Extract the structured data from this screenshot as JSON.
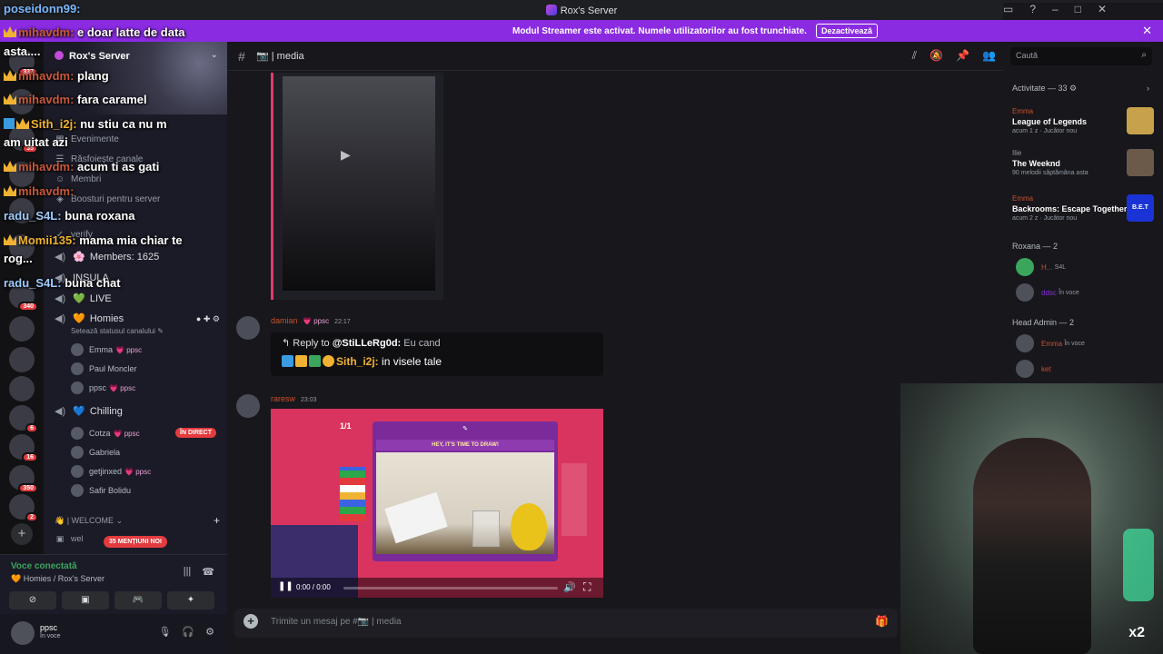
{
  "window": {
    "title": "Rox's Server"
  },
  "banner": {
    "text": "Modul Streamer este activat. Numele utilizatorilor au fost trunchiate.",
    "button": "Dezactivează",
    "close": "✕"
  },
  "overlay": {
    "top_user": "poseidonn99:",
    "lines": [
      {
        "name": "mihavdm:",
        "text": " e doar latte de data"
      },
      {
        "name": "",
        "text": "asta...."
      },
      {
        "name": "mihavdm:",
        "text": " plang"
      },
      {
        "name": "mihavdm:",
        "text": " fara caramel"
      },
      {
        "name": "Sith_i2j:",
        "text": " nu stiu ca nu m"
      },
      {
        "name": "",
        "text": "am uitat azi"
      },
      {
        "name": "mihavdm:",
        "text": " acum ti as gati"
      },
      {
        "name": "mihavdm:",
        "text": ""
      },
      {
        "name": "radu_S4L:",
        "text": " buna roxana"
      },
      {
        "name": "Momii135:",
        "text": " mama mia chiar te"
      },
      {
        "name": "",
        "text": "rog..."
      },
      {
        "name": "radu_S4L:",
        "text": " buna chat"
      }
    ]
  },
  "rail": {
    "badges": [
      "337",
      "35",
      "340",
      "6",
      "16",
      "350",
      "2"
    ]
  },
  "sidebar": {
    "server_name": "Rox's Server",
    "rows": [
      {
        "icon": "calendar-icon",
        "label": "Evenimente"
      },
      {
        "icon": "browse-icon",
        "label": "Răsfoiește canale"
      },
      {
        "icon": "members-icon",
        "label": "Membri"
      },
      {
        "icon": "boost-icon",
        "label": "Boosturi pentru server"
      },
      {
        "icon": "check-icon",
        "label": "verify"
      }
    ],
    "voice": [
      {
        "label": "Members: 1625",
        "heart": "🌸"
      },
      {
        "label": "INSULA",
        "heart": ""
      },
      {
        "label": "LIVE",
        "heart": "💚"
      },
      {
        "label": "Homies",
        "heart": "🧡"
      },
      {
        "label": "Chilling",
        "heart": "💙"
      }
    ],
    "homies_status": "Setează statusul canalului",
    "homies_users": [
      {
        "name": "Emma",
        "tag": "💗 ppsc"
      },
      {
        "name": "Paul Moncler",
        "tag": ""
      },
      {
        "name": "ppsc",
        "tag": "💗 ppsc"
      }
    ],
    "chilling_users": [
      {
        "name": "Cotza",
        "tag": "💗 ppsc",
        "live": "ÎN DIRECT"
      },
      {
        "name": "Gabriela",
        "tag": "",
        "live": ""
      },
      {
        "name": "getjinxed",
        "tag": "💗 ppsc",
        "live": ""
      },
      {
        "name": "Safir Bolidu",
        "tag": "",
        "live": ""
      }
    ],
    "welcome": "👋 | WELCOME",
    "welcome_sub": "wel",
    "mentions": "35 MENȚIUNI NOI"
  },
  "voice_panel": {
    "title": "Voce conectată",
    "sub": "Homies / Rox's Server"
  },
  "user_panel": {
    "name": "ppsc",
    "status": "În voce"
  },
  "channel": {
    "name": "media",
    "hash": "#"
  },
  "messages": [
    {
      "author": "damian",
      "tag": "💗 ppsc",
      "time": "22:17"
    },
    {
      "author": "raresw",
      "tag": "",
      "time": "23:03"
    }
  ],
  "reply": {
    "prefix": "Reply to ",
    "target": "@StiLLeRg0d:",
    "quote": " Eu cand",
    "user": "Sith_i2j:",
    "text": " in visele tale"
  },
  "game": {
    "counter": "1/1",
    "prompt": "HEY, IT'S TIME TO DRAW!",
    "time": "0:00 / 0:00"
  },
  "composer": {
    "placeholder": "Trimite un mesaj pe #📷 | media"
  },
  "right_panel": {
    "search_placeholder": "Caută",
    "activity_header": "Activitate — 33",
    "activities": [
      {
        "who": "Emma",
        "what": "League of Legends",
        "meta": "acum 1 z · Jucător nou",
        "color": "#c7a24a"
      },
      {
        "who": "Ilie",
        "what": "The Weeknd",
        "meta": "90 melodii săptămâna asta",
        "color": "#6b5a4a"
      },
      {
        "who": "Emma",
        "what": "Backrooms: Escape Together",
        "meta": "acum 2 z · Jucător nou",
        "color": "#1a33d6"
      }
    ],
    "groups": [
      {
        "label": "Roxana — 2",
        "members": [
          {
            "n": "H...",
            "s": "S4L"
          },
          {
            "n": "ddsc",
            "s": "În voce"
          }
        ]
      },
      {
        "label": "Head Admin — 2",
        "members": [
          {
            "n": "Emma",
            "s": "În voce"
          },
          {
            "n": "ket",
            "s": ""
          }
        ]
      }
    ]
  },
  "webcam": {
    "badge": "x2"
  },
  "colors": {
    "accent": "#8a2be2",
    "live": "#e33b3e",
    "voice_green": "#3ba55d"
  }
}
